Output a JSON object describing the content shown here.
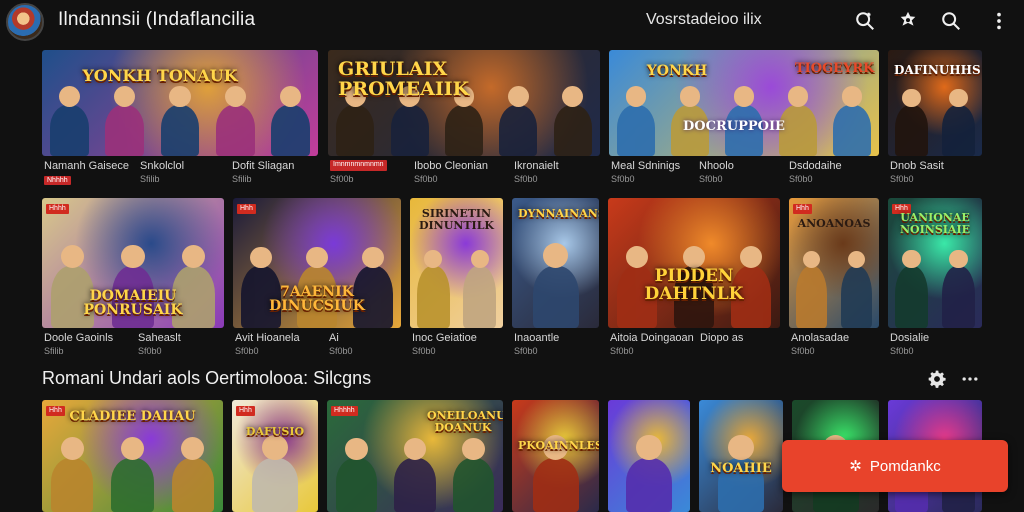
{
  "header": {
    "app_title": "Ilndannsii (Indaflancilia",
    "center_title": "Vosrstadeioo ilix",
    "icons": [
      "search-zoom-icon",
      "puzzle-icon",
      "search-icon",
      "more-vert-icon"
    ]
  },
  "rows": [
    {
      "cards": [
        {
          "art": "Yonkh  Tonauk",
          "meta": "Namanh Gaisece",
          "sub": "",
          "badge": "Nhhhh",
          "colors": [
            "#1f4f8a",
            "#e0a03a",
            "#c23d9a"
          ]
        },
        {
          "art": "",
          "meta": "Snkolclol",
          "sub": "Sfilib",
          "badge": "",
          "colors": [
            "#6a3b1e",
            "#e07a2e",
            "#2a1a12"
          ]
        },
        {
          "art": "",
          "meta": "Dofit Sliagan",
          "sub": "Sfilib",
          "badge": "",
          "colors": [
            "#4a7fb8",
            "#e9b37a",
            "#7a3b1e"
          ]
        },
        {
          "art": "Griulaix Promeaiik",
          "meta": "",
          "sub": "Sf00b",
          "badge": "Imnmnmnmnmn",
          "colors": [
            "#3a2a1c",
            "#c46a2a",
            "#1f2a4a"
          ]
        },
        {
          "art": "",
          "meta": "Ibobo Cleonian",
          "sub": "Sf0b0",
          "badge": "",
          "colors": [
            "#1b2a48",
            "#a8392a",
            "#3a2414"
          ]
        },
        {
          "art": "",
          "meta": "Ikronaielt",
          "sub": "Sf0b0",
          "badge": "",
          "colors": [
            "#2a2a4a",
            "#e04a2a",
            "#1a1a2a"
          ]
        },
        {
          "art": "Yonkh",
          "meta": "Meal Sdninigs",
          "sub": "Sf0b0",
          "badge": "",
          "colors": [
            "#3a8ad8",
            "#9a4ad8",
            "#e8c24a"
          ]
        },
        {
          "art": "Docruppoie",
          "meta": "Nhoolo",
          "sub": "Sf0b0",
          "badge": "",
          "colors": [
            "#6a4ad8",
            "#e8a84a",
            "#3a2a6a"
          ]
        },
        {
          "art": "Tiogeyrk",
          "meta": "Dsdodaihe",
          "sub": "Sf0b0",
          "badge": "",
          "colors": [
            "#3aa8d8",
            "#d84a8a",
            "#e8c24a"
          ]
        },
        {
          "art": "Dafinuhhs",
          "meta": "Dnob Sasit",
          "sub": "Sf0b0",
          "badge": "",
          "colors": [
            "#2a1a12",
            "#e06a1a",
            "#1a2a4a"
          ]
        }
      ]
    },
    {
      "cards": [
        {
          "art": "Domaieiu Ponrusaik",
          "meta": "Doole Gaoinls",
          "sub": "Sfilib",
          "badge": "",
          "tag": "Hhhh",
          "colors": [
            "#d8c88a",
            "#2a4a8a",
            "#8a3ab8"
          ]
        },
        {
          "art": "",
          "meta": "Saheaslt",
          "sub": "Sf0b0",
          "badge": "",
          "colors": [
            "#e8e0c8",
            "#2a2a2a",
            "#c83a3a"
          ]
        },
        {
          "art": "7Aaenik Dinucsiuk",
          "meta": "Avit Hioanela",
          "sub": "Sf0b0",
          "badge": "",
          "tag": "Hhh",
          "colors": [
            "#1a1a3a",
            "#7a3ad8",
            "#e8a83a"
          ]
        },
        {
          "art": "",
          "meta": "Ai",
          "sub": "Sf0b0",
          "badge": "",
          "colors": [
            "#2a2a5a",
            "#e8a84a",
            "#3a3aa8"
          ]
        },
        {
          "art": "Sirinetin Dinuntilk",
          "meta": "Inoc Geiatioe",
          "sub": "Sf0b0",
          "badge": "",
          "colors": [
            "#e8b83a",
            "#8a3ad8",
            "#f0d0a0"
          ]
        },
        {
          "art": "Dynnainans",
          "meta": "Inaoantle",
          "sub": "Sf0b0",
          "badge": "",
          "colors": [
            "#3a5a8a",
            "#a8c8e8",
            "#2a2a3a"
          ]
        },
        {
          "art": "Pidden Dahtnlk",
          "meta": "Aitoia Doingaoan",
          "sub": "Sf0b0",
          "badge": "",
          "colors": [
            "#c83a1a",
            "#f08a2a",
            "#3a1a12"
          ]
        },
        {
          "art": "",
          "meta": "Diopo as",
          "sub": "",
          "badge": "",
          "colors": [
            "#3a1a12",
            "#e84a1a",
            "#2a2a2a"
          ]
        },
        {
          "art": "Anoanoas",
          "meta": "Anolasadae",
          "sub": "Sf0b0",
          "badge": "",
          "tag": "Hhh",
          "colors": [
            "#e89a3a",
            "#6a3a1a",
            "#2a4a6a"
          ]
        },
        {
          "art": "Uanionae Noinsiaie",
          "meta": "Dosialie",
          "sub": "Sf0b0",
          "badge": "",
          "tag": "Hhh",
          "colors": [
            "#1a4a3a",
            "#3ae8a8",
            "#2a2a5a"
          ]
        }
      ]
    }
  ],
  "section": {
    "title": "Romani Undari aols Oertimolooa: Silcgns",
    "icons": [
      "gear-icon",
      "more-horiz-icon"
    ]
  },
  "bottom_row": [
    {
      "art": "Cladiee Daiiau",
      "tag": "Hhh",
      "colors": [
        "#e8a83a",
        "#8a3ad8",
        "#3a8a3a"
      ]
    },
    {
      "art": "Dafusio",
      "tag": "Hhh",
      "colors": [
        "#f0e8d8",
        "#8a3a8a",
        "#e8c83a"
      ]
    },
    {
      "art": "Oneiloanu Doanuk",
      "tag": "Hhhhh",
      "colors": [
        "#2a6a3a",
        "#e8b83a",
        "#3a2a5a"
      ]
    },
    {
      "art": "Pkoainnles",
      "tag": "",
      "colors": [
        "#c83a1a",
        "#e8c83a",
        "#2a2a4a"
      ]
    },
    {
      "art": "",
      "tag": "",
      "colors": [
        "#6a3ad8",
        "#e8b83a",
        "#3a8ad8"
      ]
    },
    {
      "art": "Noahie",
      "tag": "",
      "colors": [
        "#3a8ad8",
        "#e8a83a",
        "#2a2a3a"
      ]
    },
    {
      "art": "",
      "tag": "",
      "colors": [
        "#1a4a2a",
        "#3ae86a",
        "#2a2a2a"
      ]
    },
    {
      "art": "",
      "tag": "",
      "colors": [
        "#6a3ad8",
        "#e83a8a",
        "#2a2a5a"
      ]
    }
  ],
  "cta": {
    "label": "Pomdankc",
    "icon": "sparkle-icon"
  }
}
